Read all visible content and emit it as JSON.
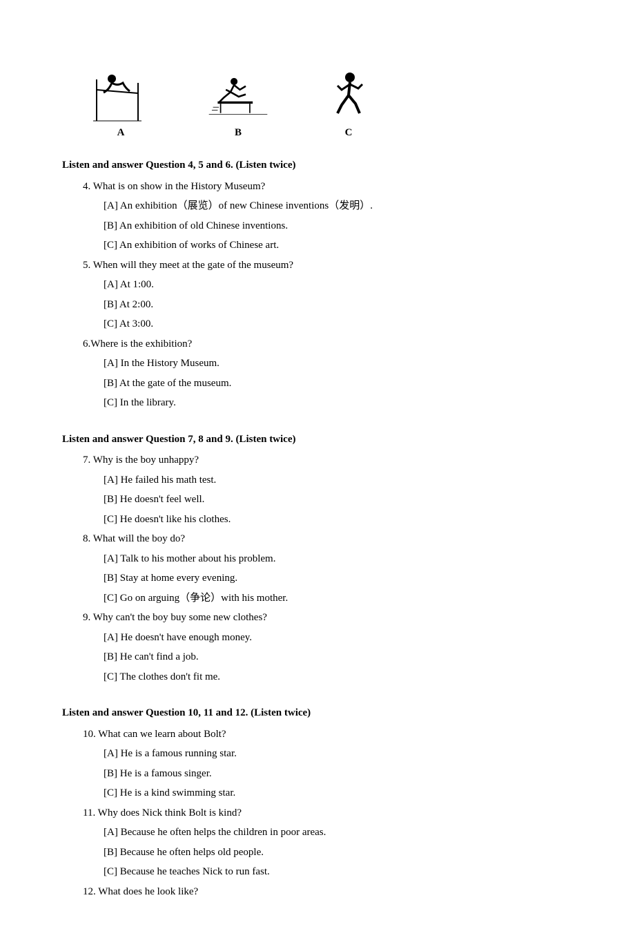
{
  "images": {
    "a_label": "A",
    "b_label": "B",
    "c_label": "C"
  },
  "section1": {
    "header": "Listen and answer Question 4, 5 and 6.  (Listen twice)",
    "q4": {
      "prompt": "4. What is on show in the History Museum?",
      "a": "[A] An exhibition（展览）of new Chinese inventions（发明）.",
      "b": "[B] An exhibition of old Chinese inventions.",
      "c": "[C] An exhibition of works of Chinese art."
    },
    "q5": {
      "prompt": "5. When will they meet at the gate of the museum?",
      "a": "[A] At 1:00.",
      "b": "[B] At 2:00.",
      "c": "[C] At 3:00."
    },
    "q6": {
      "prompt": "6.Where is the exhibition?",
      "a": "[A] In the History Museum.",
      "b": "[B] At the gate of the museum.",
      "c": "[C] In the library."
    }
  },
  "section2": {
    "header": "Listen and answer Question 7, 8 and 9.  (Listen twice)",
    "q7": {
      "prompt": "7. Why is the boy unhappy?",
      "a": "[A] He failed his math test.",
      "b": "[B] He doesn't feel well.",
      "c": "[C] He doesn't like his clothes."
    },
    "q8": {
      "prompt": "8. What will the boy do?",
      "a": "[A] Talk to his mother about his problem.",
      "b": "[B] Stay at home every evening.",
      "c": "[C] Go on arguing（争论）with his mother."
    },
    "q9": {
      "prompt": "9. Why can't the boy buy some new clothes?",
      "a": "[A] He doesn't have enough money.",
      "b": "[B] He can't find a job.",
      "c": "[C] The clothes don't fit me."
    }
  },
  "section3": {
    "header": "Listen and answer Question 10, 11 and 12.  (Listen twice)",
    "q10": {
      "prompt": "10. What can we learn about Bolt?",
      "a": "[A] He is a famous running star.",
      "b": "[B] He is a famous singer.",
      "c": "[C] He is a kind swimming star."
    },
    "q11": {
      "prompt": "11. Why does Nick think Bolt is kind?",
      "a": "[A] Because he often helps the children in poor areas.",
      "b": "[B] Because he often helps old people.",
      "c": "[C] Because he teaches Nick to run fast."
    },
    "q12": {
      "prompt": "12. What does he look like?"
    }
  }
}
